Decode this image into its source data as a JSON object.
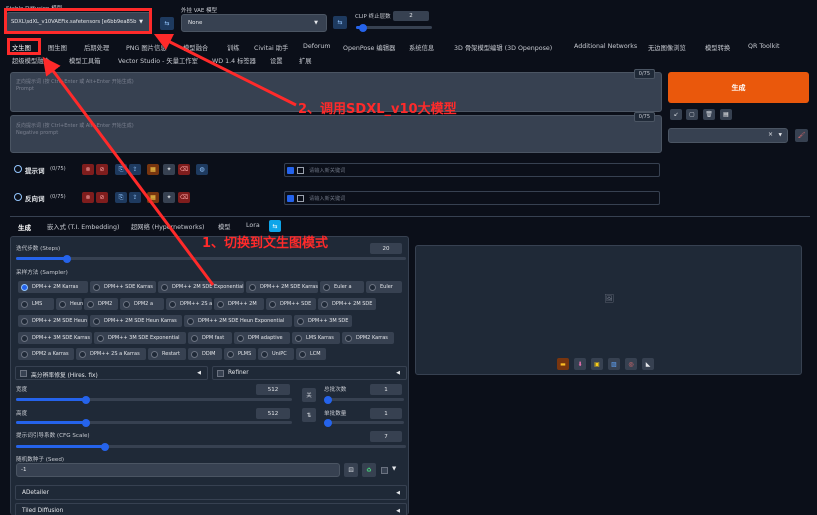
{
  "top": {
    "checkpoint_label": "Stable Diffusion 模型",
    "checkpoint_value": "SDXL\\sdXL_v10VAEFix.safetensors [e6bb9ea85b",
    "vae_label": "外挂 VAE 模型",
    "vae_value": "None",
    "clip_label": "CLIP 终止层数",
    "clip_value": "2",
    "clip_level": 0.08
  },
  "tabs_row1": [
    "文生图",
    "图生图",
    "后期处理",
    "PNG 图片信息",
    "模型融合",
    "训练",
    "Civitai 助手",
    "Deforum",
    "OpenPose 编辑器",
    "系统信息",
    "3D 骨架模型编辑 (3D Openpose)",
    "Additional Networks",
    "无边图像浏览",
    "模型转换",
    "QR Toolkit"
  ],
  "tabs_row2": [
    "超级模型融合",
    "模型工具箱",
    "Vector Studio - 矢量工作室",
    "WD 1.4 标签器",
    "设置",
    "扩展"
  ],
  "prompt": {
    "placeholder_cn": "正向提示词 (按 Ctrl+Enter 或 Alt+Enter 开始生成)",
    "placeholder_en": "Prompt",
    "counter": "0/75",
    "neg_placeholder_cn": "反向提示词 (按 Ctrl+Enter 或 Alt+Enter 开始生成)",
    "neg_placeholder_en": "Negative prompt",
    "neg_counter": "0/75"
  },
  "generate_label": "生成",
  "tag_rows": {
    "pos_title": "提示词",
    "pos_count": "(0/75)",
    "neg_title": "反向词",
    "neg_count": "(0/75)",
    "pos_input_placeholder": "请输入新关键词",
    "neg_input_placeholder": "请输入新关键词"
  },
  "subtabs": [
    "生成",
    "嵌入式 (T.I. Embedding)",
    "超网络 (Hypernetworks)",
    "模型",
    "Lora"
  ],
  "steps": {
    "label": "迭代步数 (Steps)",
    "value": "20",
    "level": 0.13
  },
  "sampler": {
    "label": "采样方法 (Sampler)",
    "selected": "DPM++ 2M Karras",
    "options": [
      "DPM++ 2M Karras",
      "DPM++ SDE Karras",
      "DPM++ 2M SDE Exponential",
      "DPM++ 2M SDE Karras",
      "Euler a",
      "Euler",
      "LMS",
      "Heun",
      "DPM2",
      "DPM2 a",
      "DPM++ 2S a",
      "DPM++ 2M",
      "DPM++ SDE",
      "DPM++ 2M SDE",
      "DPM++ 2M SDE Heun",
      "DPM++ 2M SDE Heun Karras",
      "DPM++ 2M SDE Heun Exponential",
      "DPM++ 3M SDE",
      "DPM++ 3M SDE Karras",
      "DPM++ 3M SDE Exponential",
      "DPM fast",
      "DPM adaptive",
      "LMS Karras",
      "DPM2 Karras",
      "DPM2 a Karras",
      "DPM++ 2S a Karras",
      "Restart",
      "DDIM",
      "PLMS",
      "UniPC",
      "LCM"
    ]
  },
  "hires_label": "高分辨率修复 (Hires. fix)",
  "refiner_label": "Refiner",
  "width": {
    "label": "宽度",
    "value": "512",
    "level": 0.25
  },
  "height": {
    "label": "高度",
    "value": "512",
    "level": 0.25
  },
  "swap_label": "关",
  "batch_count": {
    "label": "总批次数",
    "value": "1",
    "level": 0.0
  },
  "batch_size": {
    "label": "单批数量",
    "value": "1",
    "level": 0.0
  },
  "cfg": {
    "label": "提示词引导系数 (CFG Scale)",
    "value": "7",
    "level": 0.23
  },
  "seed": {
    "label": "随机数种子 (Seed)",
    "value": "-1"
  },
  "accordions": [
    "ADetailer",
    "Tiled Diffusion"
  ],
  "annotations": {
    "one": "1、切换到文生图模式",
    "two": "2、调用SDXL_v10大模型"
  },
  "colors": {
    "accent": "#ea580c",
    "annotation": "#ff2a2a",
    "bg": "#0b0f19"
  }
}
